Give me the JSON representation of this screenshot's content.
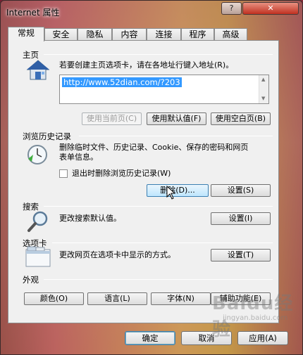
{
  "window": {
    "title": "Internet 属性",
    "help_glyph": "?",
    "close_glyph": "✕"
  },
  "tabs": [
    {
      "label": "常规"
    },
    {
      "label": "安全"
    },
    {
      "label": "隐私"
    },
    {
      "label": "内容"
    },
    {
      "label": "连接"
    },
    {
      "label": "程序"
    },
    {
      "label": "高级"
    }
  ],
  "home": {
    "title": "主页",
    "description": "若要创建主页选项卡，请在各地址行键入地址(R)。",
    "url": "http://www.52dian.com/?203",
    "use_current": "使用当前页(C)",
    "use_default": "使用默认值(F)",
    "use_blank": "使用空白页(B)"
  },
  "history": {
    "title": "浏览历史记录",
    "description_line1": "删除临时文件、历史记录、Cookie、保存的密码和网页",
    "description_line2": "表单信息。",
    "checkbox_label": "退出时删除浏览历史记录(W)",
    "delete_button": "删除(D)...",
    "settings_button": "设置(S)"
  },
  "search": {
    "title": "搜索",
    "description": "更改搜索默认值。",
    "settings_button": "设置(I)"
  },
  "tabs_section": {
    "title": "选项卡",
    "description": "更改网页在选项卡中显示的方式。",
    "settings_button": "设置(T)"
  },
  "appearance": {
    "title": "外观",
    "colors": "颜色(O)",
    "languages": "语言(L)",
    "fonts": "字体(N)",
    "accessibility": "辅助功能(E)"
  },
  "footer": {
    "ok": "确定",
    "cancel": "取消",
    "apply": "应用(A)"
  },
  "watermark": {
    "text": "Baidu经验",
    "sub": "jingyan.baidu.com"
  }
}
